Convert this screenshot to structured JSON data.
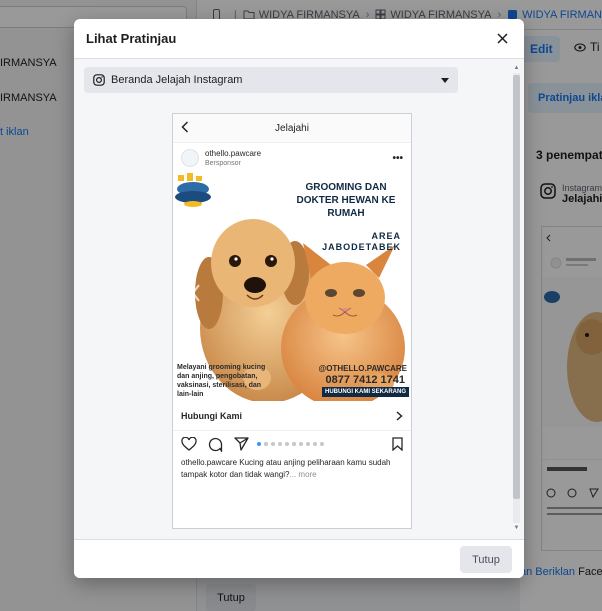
{
  "background": {
    "sidebar": {
      "items": [
        "IRMANSYA",
        "IRMANSYA"
      ],
      "link": "t iklan"
    },
    "breadcrumb": {
      "items": [
        "WIDYA FIRMANSYA",
        "WIDYA FIRMANSYA",
        "WIDYA FIRMAN"
      ]
    },
    "right_panel": {
      "edit_label": "Edit",
      "view_label": "Ti",
      "preview_button": "Pratinjau iklan",
      "placements_title": "3 penempata",
      "ig_line1": "Instagram",
      "ig_line2": "Jelajahi",
      "footer_prefix": "an Beriklan",
      "footer_suffix": "Face"
    },
    "bottom_button": "Tutup"
  },
  "modal": {
    "title": "Lihat Pratinjau",
    "placement_select": "Beranda Jelajah Instagram",
    "footer_close": "Tutup"
  },
  "post": {
    "nav_title": "Jelajahi",
    "account": "othello.pawcare",
    "sponsored": "Bersponsor",
    "creative": {
      "headline": "GROOMING DAN DOKTER HEWAN KE RUMAH",
      "area": "AREA JABODETABEK",
      "services": "Melayani grooming kucing dan anjing, pengobatan, vaksinasi, sterilisasi, dan lain-lain",
      "handle": "@OTHELLO.PAWCARE",
      "phone": "0877 7412 1741",
      "cta_banner": "HUBUNGI KAMI SEKARANG"
    },
    "cta_label": "Hubungi Kami",
    "carousel": {
      "count": 10,
      "active_index": 0
    },
    "caption_account": "othello.pawcare",
    "caption_text": " Kucing atau anjing peliharaan kamu sudah tampak kotor dan tidak wangi?",
    "caption_more": "... more"
  },
  "colors": {
    "accent": "#1877f2",
    "overlay": "rgba(0,0,0,0.40)",
    "brand_navy": "#102a43",
    "carousel_active": "#3897f0"
  }
}
